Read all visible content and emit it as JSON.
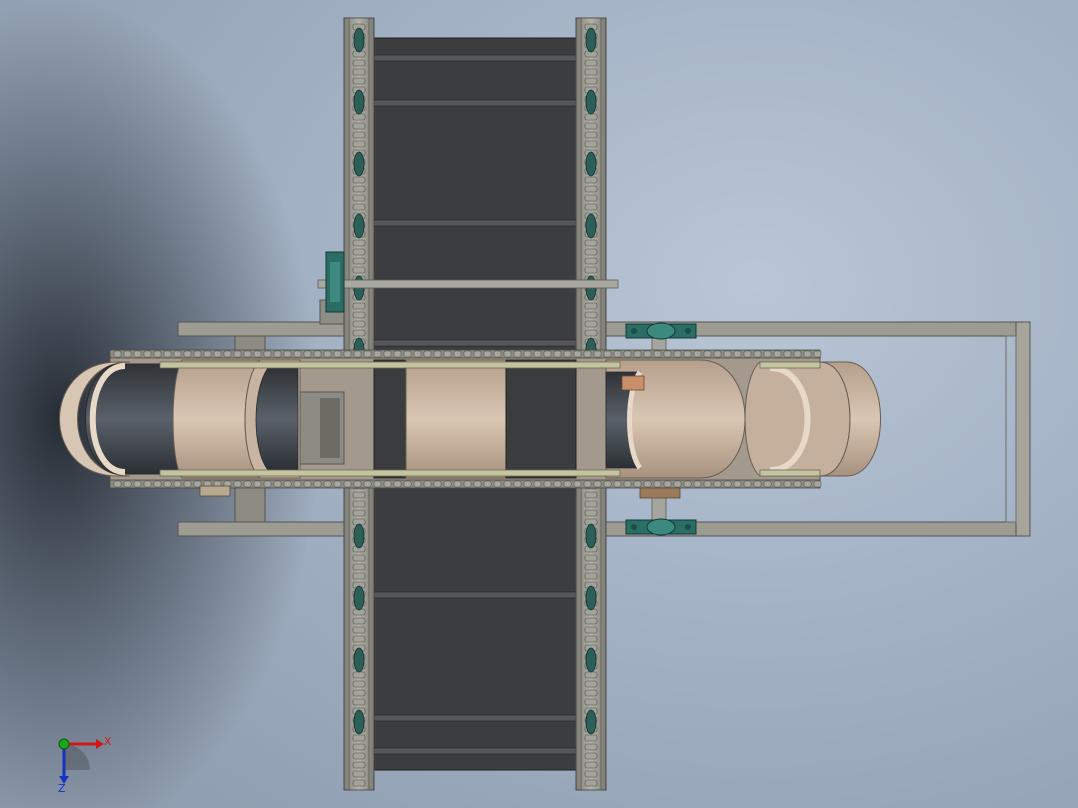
{
  "triad": {
    "x_label": "X",
    "z_label": "Z",
    "colors": {
      "x_axis": "#d01818",
      "y_axis": "#18a818",
      "z_axis": "#1830c8"
    }
  },
  "colors": {
    "belt": "#3a3a3a",
    "belt_slat": "#2a2a2a",
    "chain": "#8e8e86",
    "frame": "#9a9a90",
    "bearing_block": "#2a6e66",
    "bucket_tan": "#cdb8a4",
    "bucket_rim": "#e4d4c4",
    "rail": "#b8b89a"
  }
}
